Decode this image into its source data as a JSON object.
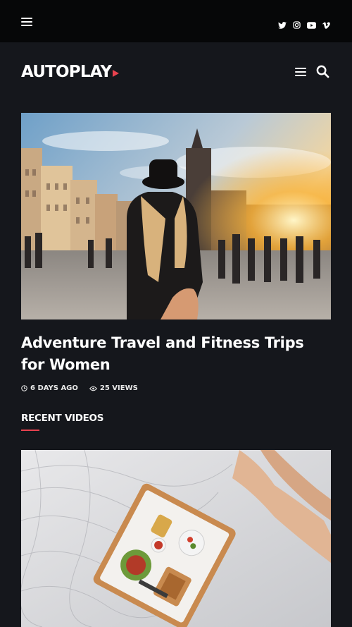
{
  "topbar": {
    "social_icons": [
      "twitter-icon",
      "instagram-icon",
      "youtube-icon",
      "vimeo-icon"
    ]
  },
  "header": {
    "logo_text": "AUTOPLAY",
    "accent_color": "#e8424f"
  },
  "featured": {
    "title": "Adventure Travel and Fitness Trips for Women",
    "time_ago": "6 DAYS AGO",
    "views": "25 VIEWS"
  },
  "recent_videos": {
    "heading": "RECENT VIDEOS"
  }
}
